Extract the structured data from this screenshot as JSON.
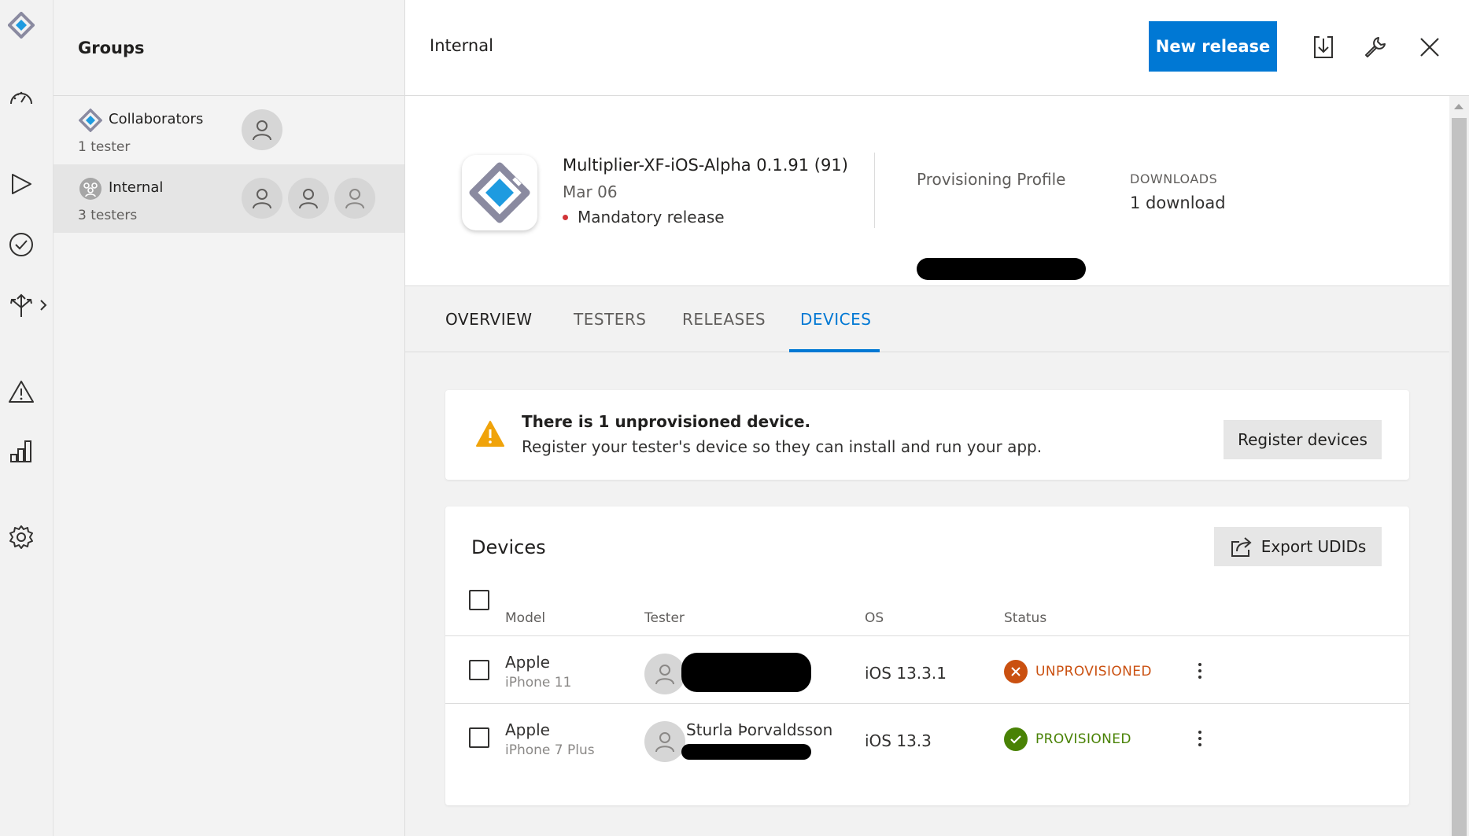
{
  "rail": {
    "items": [
      {
        "name": "app-logo-icon"
      },
      {
        "name": "dashboard-icon"
      },
      {
        "name": "build-play-icon"
      },
      {
        "name": "test-check-icon"
      },
      {
        "name": "distribute-icon"
      },
      {
        "name": "diagnostics-warning-icon"
      },
      {
        "name": "analytics-bar-icon"
      },
      {
        "name": "settings-gear-icon"
      }
    ]
  },
  "groups": {
    "title": "Groups",
    "items": [
      {
        "name": "Collaborators",
        "count": "1 tester",
        "selected": false
      },
      {
        "name": "Internal",
        "count": "3 testers",
        "selected": true
      }
    ]
  },
  "header": {
    "title": "Internal",
    "new_release_label": "New release",
    "download_icon": "download-icon",
    "settings_icon": "wrench-icon",
    "close_icon": "close-icon"
  },
  "release": {
    "name": "Multiplier-XF-iOS-Alpha 0.1.91 (91)",
    "date": "Mar 06",
    "mandatory": "Mandatory release",
    "provisioning_label": "Provisioning Profile",
    "downloads_label": "DOWNLOADS",
    "downloads_value": "1 download"
  },
  "tabs": [
    {
      "label": "OVERVIEW",
      "active": false
    },
    {
      "label": "TESTERS",
      "active": false
    },
    {
      "label": "RELEASES",
      "active": false
    },
    {
      "label": "DEVICES",
      "active": true
    }
  ],
  "warning": {
    "title": "There is 1 unprovisioned device.",
    "body": "Register your tester's device so they can install and run your app.",
    "button_label": "Register devices"
  },
  "devices": {
    "title": "Devices",
    "export_label": "Export UDIDs",
    "columns": [
      "Model",
      "Tester",
      "OS",
      "Status"
    ],
    "rows": [
      {
        "make": "Apple",
        "model": "iPhone 11",
        "tester": "",
        "os": "iOS 13.3.1",
        "status": "UNPROVISIONED"
      },
      {
        "make": "Apple",
        "model": "iPhone 7 Plus",
        "tester": "Sturla Þorvaldsson",
        "os": "iOS 13.3",
        "status": "PROVISIONED"
      }
    ]
  },
  "colors": {
    "accent": "#0078d4",
    "unprovisioned": "#ca5010",
    "provisioned": "#498205",
    "warning": "#f0a30a"
  }
}
